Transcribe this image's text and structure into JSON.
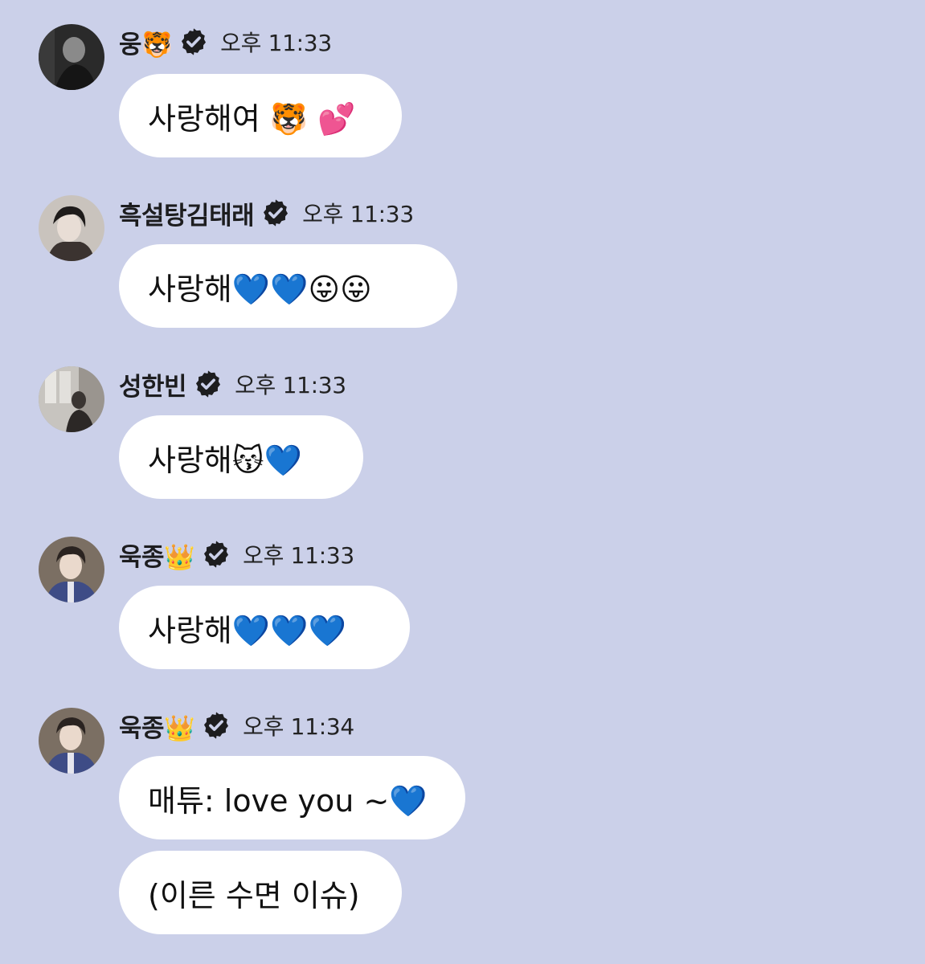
{
  "messages": [
    {
      "sender": "웅🐯",
      "time": "오후 11:33",
      "bubbles": [
        "사랑해여 🐯 💕"
      ]
    },
    {
      "sender": "흑설탕김태래",
      "time": "오후 11:33",
      "bubbles": [
        "사랑해💙💙😛😛"
      ]
    },
    {
      "sender": "성한빈",
      "time": "오후 11:33",
      "bubbles": [
        "사랑해😽💙"
      ]
    },
    {
      "sender": "욱종👑",
      "time": "오후 11:33",
      "bubbles": [
        "사랑해💙💙💙"
      ]
    },
    {
      "sender": "욱종👑",
      "time": "오후 11:34",
      "bubbles": [
        "매튜: love you ~💙",
        "(이른 수면 이슈)"
      ]
    }
  ],
  "colors": {
    "background": "#cbd0e9",
    "bubble": "#ffffff",
    "verified_badge": "#1d1d1f"
  },
  "icons": {
    "verified": "verified-badge-icon"
  }
}
